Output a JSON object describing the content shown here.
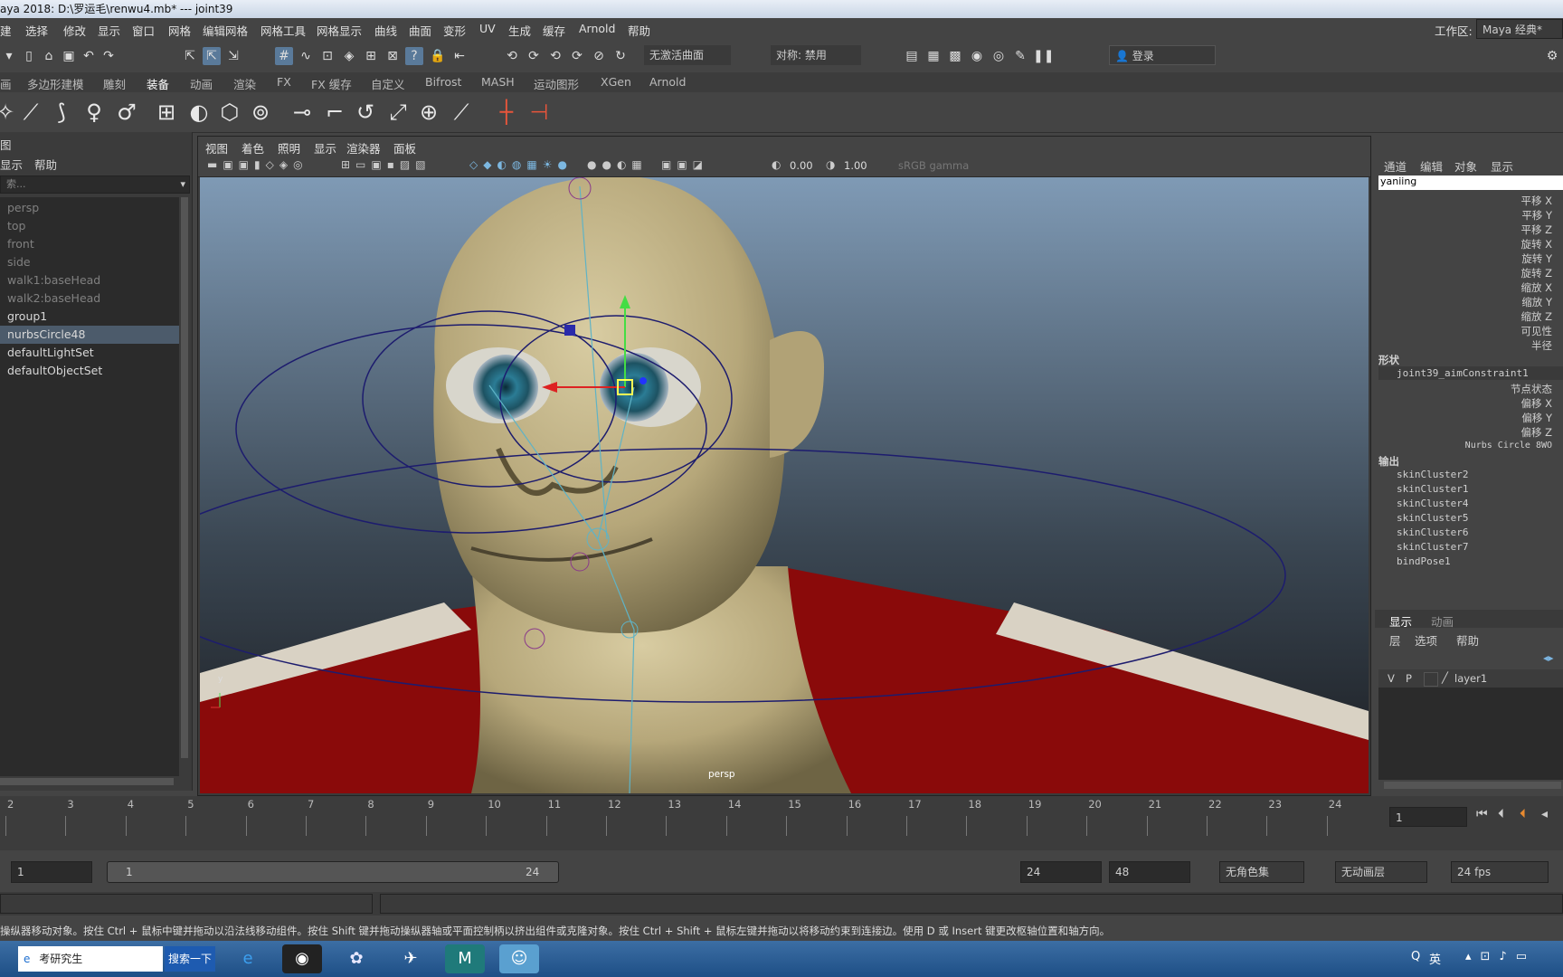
{
  "title": "aya 2018: D:\\罗运毛\\renwu4.mb*   ---   joint39",
  "menu": [
    "建",
    "选择",
    "修改",
    "显示",
    "窗口",
    "网格",
    "编辑网格",
    "网格工具",
    "网格显示",
    "曲线",
    "曲面",
    "变形",
    "UV",
    "生成",
    "缓存",
    "Arnold",
    "帮助"
  ],
  "workspace": {
    "label": "工作区:",
    "value": "Maya 经典*"
  },
  "status": {
    "live_surface": "无激活曲面",
    "symmetry": "对称: 禁用",
    "login": "登录"
  },
  "shelf_tabs": [
    "画",
    "多边形建模",
    "雕刻",
    "装备",
    "动画",
    "渲染",
    "FX",
    "FX 缓存",
    "自定义",
    "Bifrost",
    "MASH",
    "运动图形",
    "XGen",
    "Arnold"
  ],
  "shelf_active": "装备",
  "outliner": {
    "header": "图",
    "menu": [
      "显示",
      "帮助"
    ],
    "search": "索...",
    "items": [
      {
        "label": "persp",
        "dim": true
      },
      {
        "label": "top",
        "dim": true
      },
      {
        "label": "front",
        "dim": true
      },
      {
        "label": "side",
        "dim": true
      },
      {
        "label": "walk1:baseHead",
        "dim": true
      },
      {
        "label": "walk2:baseHead",
        "dim": true
      },
      {
        "label": "group1",
        "dim": false
      },
      {
        "label": "nurbsCircle48",
        "dim": false,
        "selected": true
      },
      {
        "label": "defaultLightSet",
        "dim": false
      },
      {
        "label": "defaultObjectSet",
        "dim": false
      }
    ]
  },
  "viewport": {
    "menu": [
      "视图",
      "着色",
      "照明",
      "显示",
      "渲染器",
      "面板"
    ],
    "exposure": "0.00",
    "gamma": "1.00",
    "colorspace": "sRGB gamma",
    "camera": "persp",
    "axis_y": "y"
  },
  "channelbox": {
    "menu": [
      "通道",
      "编辑",
      "对象",
      "显示"
    ],
    "object_name": "yaniing",
    "attrs": [
      "平移 X",
      "平移 Y",
      "平移 Z",
      "旋转 X",
      "旋转 Y",
      "旋转 Z",
      "缩放 X",
      "缩放 Y",
      "缩放 Z",
      "可见性",
      "半径"
    ],
    "shapes_label": "形状",
    "shape_node": "joint39_aimConstraint1",
    "shape_attrs": [
      "节点状态",
      "偏移 X",
      "偏移 Y",
      "偏移 Z"
    ],
    "nurbs_label": "Nurbs Circle 8WO",
    "outputs_label": "输出",
    "outputs": [
      "skinCluster2",
      "skinCluster1",
      "skinCluster4",
      "skinCluster5",
      "skinCluster6",
      "skinCluster7",
      "bindPose1"
    ]
  },
  "layers": {
    "tabs": [
      "显示",
      "动画"
    ],
    "menu": [
      "层",
      "选项",
      "帮助"
    ],
    "row": {
      "v": "V",
      "p": "P",
      "name": "layer1"
    }
  },
  "timeline": {
    "ticks": [
      "2",
      "3",
      "4",
      "5",
      "6",
      "7",
      "8",
      "9",
      "10",
      "11",
      "12",
      "13",
      "14",
      "15",
      "16",
      "17",
      "18",
      "19",
      "20",
      "21",
      "22",
      "23",
      "24"
    ],
    "current_frame": "1"
  },
  "range": {
    "start": "1",
    "slider_start": "1",
    "slider_end": "24",
    "end": "24",
    "anim_end": "48",
    "char_set": "无角色集",
    "anim_layer": "无动画层",
    "fps": "24 fps"
  },
  "help_text": "操纵器移动对象。按住 Ctrl + 鼠标中键并拖动以沿法线移动组件。按住 Shift 键并拖动操纵器轴或平面控制柄以挤出组件或克隆对象。按住 Ctrl + Shift + 鼠标左键并拖动以将移动约束到连接边。使用 D 或 Insert 键更改枢轴位置和轴方向。",
  "taskbar": {
    "search_text": "考研究生",
    "search_btn": "搜索一下",
    "ime": "英"
  }
}
